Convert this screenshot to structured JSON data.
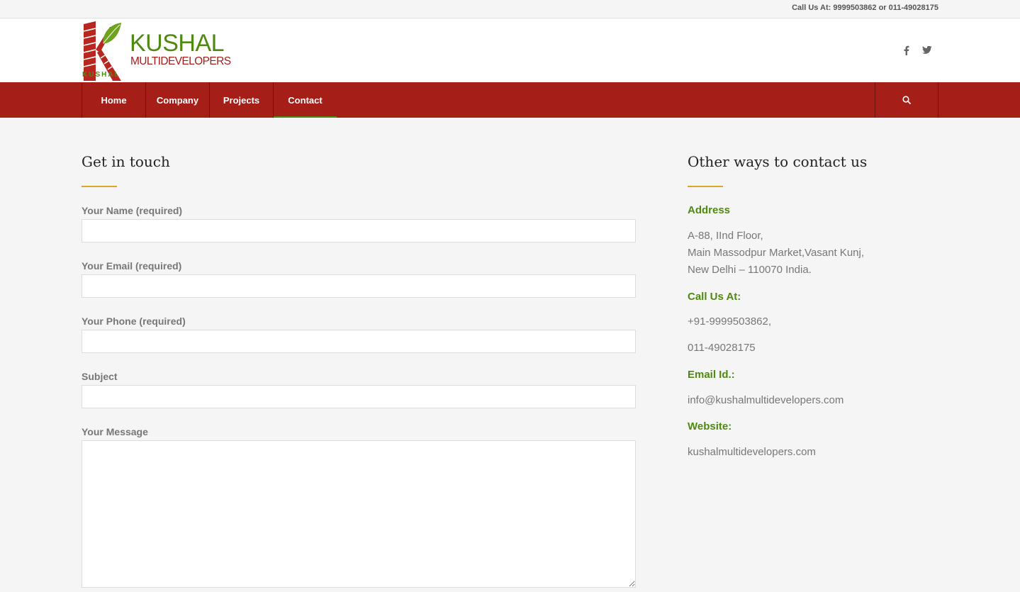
{
  "topbar": {
    "call_text": "Call Us At: 9999503862 or 011-49028175"
  },
  "logo": {
    "brand": "KUSHAL",
    "sub": "MULTIDEVELOPERS",
    "small": "KUSHAL"
  },
  "social": {
    "icons": [
      "facebook-icon",
      "twitter-icon"
    ]
  },
  "nav": {
    "items": [
      {
        "label": "Home"
      },
      {
        "label": "Company"
      },
      {
        "label": "Projects"
      },
      {
        "label": "Contact",
        "active": true
      }
    ]
  },
  "form": {
    "title": "Get in touch",
    "fields": [
      {
        "label": "Your Name (required)",
        "value": "",
        "placeholder": ""
      },
      {
        "label": "Your Email (required)",
        "value": "",
        "placeholder": ""
      },
      {
        "label": "Your Phone (required)",
        "value": "",
        "placeholder": ""
      },
      {
        "label": "Subject",
        "value": "",
        "placeholder": ""
      }
    ],
    "message": {
      "label": "Your Message",
      "value": ""
    }
  },
  "contact": {
    "title": "Other ways to contact us",
    "address_heading": "Address",
    "address_lines": [
      "A-88, IInd Floor,",
      "Main Massodpur Market,Vasant Kunj,",
      "New Delhi – 110070 India."
    ],
    "call_heading": "Call Us At:",
    "phone1": "+91-9999503862,",
    "phone2": "011-49028175",
    "email_heading": "Email Id.:",
    "email": "info@kushalmultidevelopers.com",
    "website_heading": "Website:",
    "website": "kushalmultidevelopers.com"
  },
  "colors": {
    "brand_red": "#a51f18",
    "brand_green": "#4f8a10",
    "accent_gold": "#e0a427"
  }
}
